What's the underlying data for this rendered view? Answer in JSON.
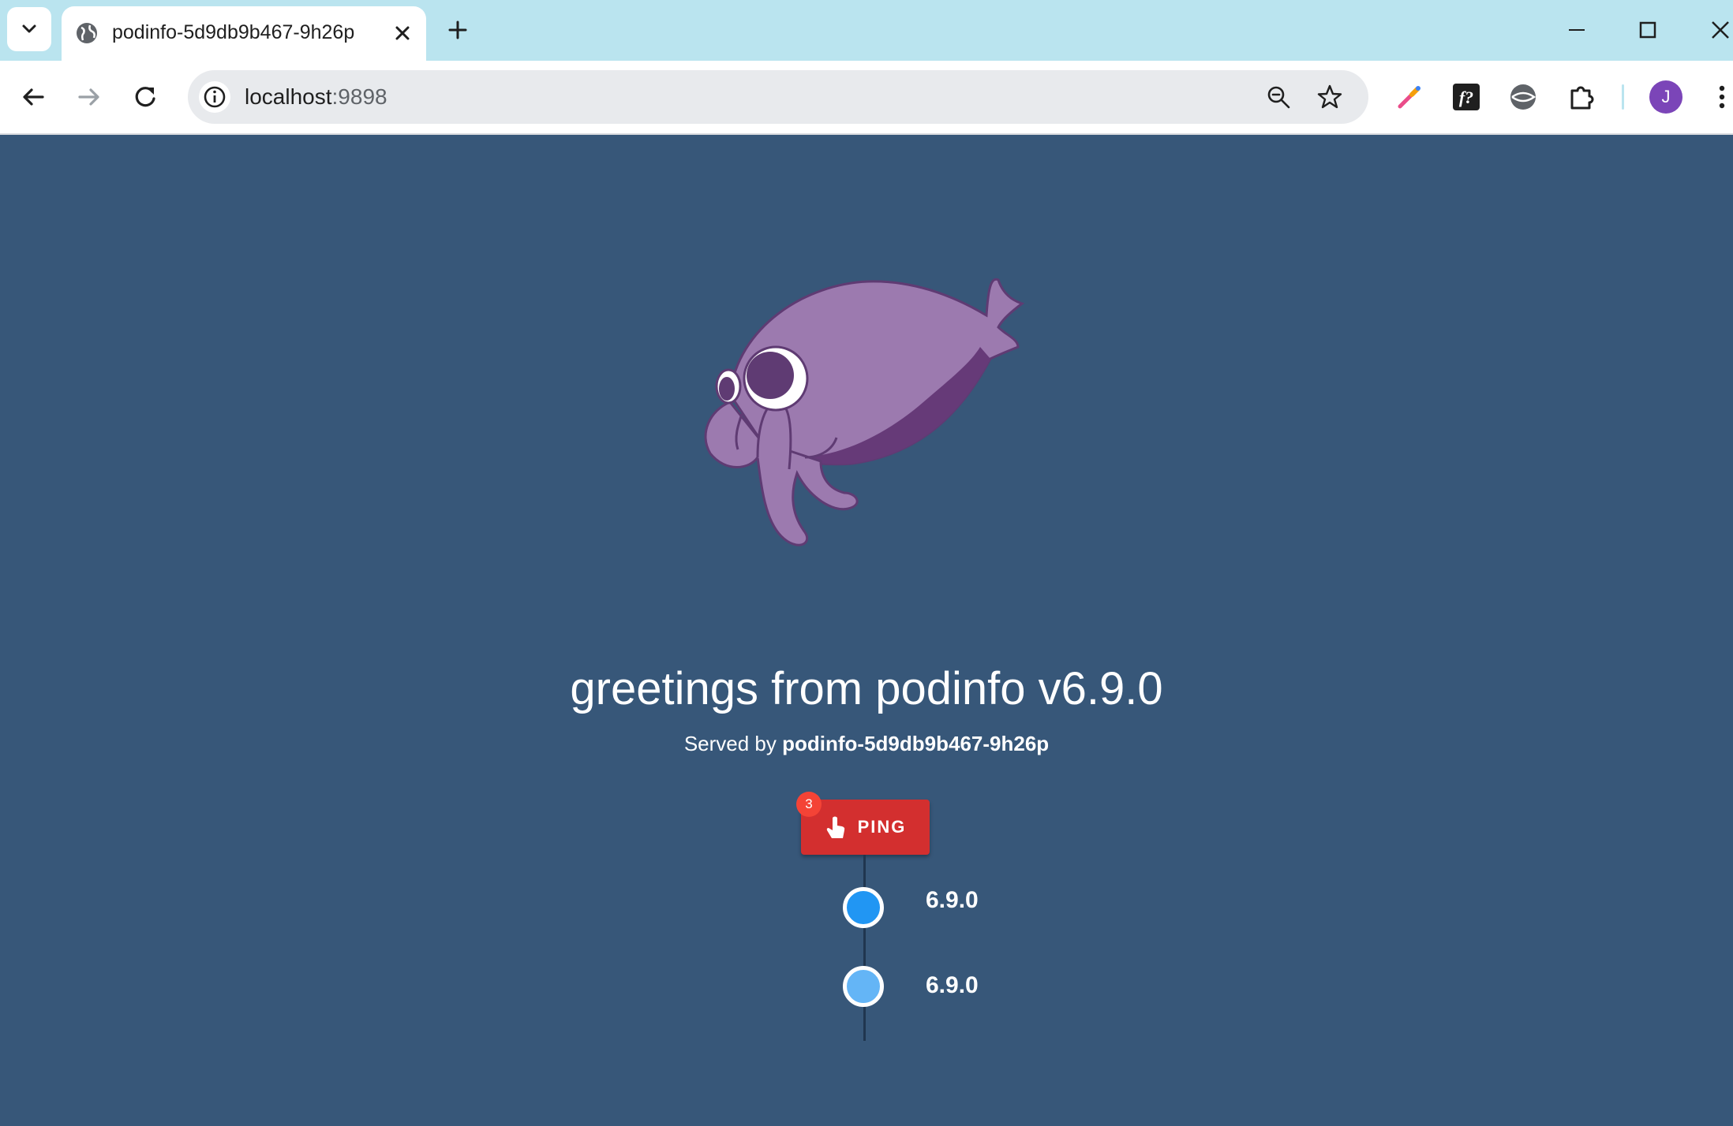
{
  "browser": {
    "tab": {
      "title": "podinfo-5d9db9b467-9h26p"
    },
    "url": {
      "host": "localhost",
      "port": ":9898"
    },
    "profile_initial": "J",
    "accent_color": "#bae4ef"
  },
  "page": {
    "heading": "greetings from podinfo v6.9.0",
    "served_prefix": "Served by",
    "served_host": "podinfo-5d9db9b467-9h26p",
    "ping": {
      "label": "PING",
      "badge": "3",
      "color": "#d32f2f"
    },
    "timeline": [
      {
        "label": "6.9.0",
        "color": "#2196f3"
      },
      {
        "label": "6.9.0",
        "color": "#64b5f6"
      }
    ],
    "background": "#375779"
  }
}
